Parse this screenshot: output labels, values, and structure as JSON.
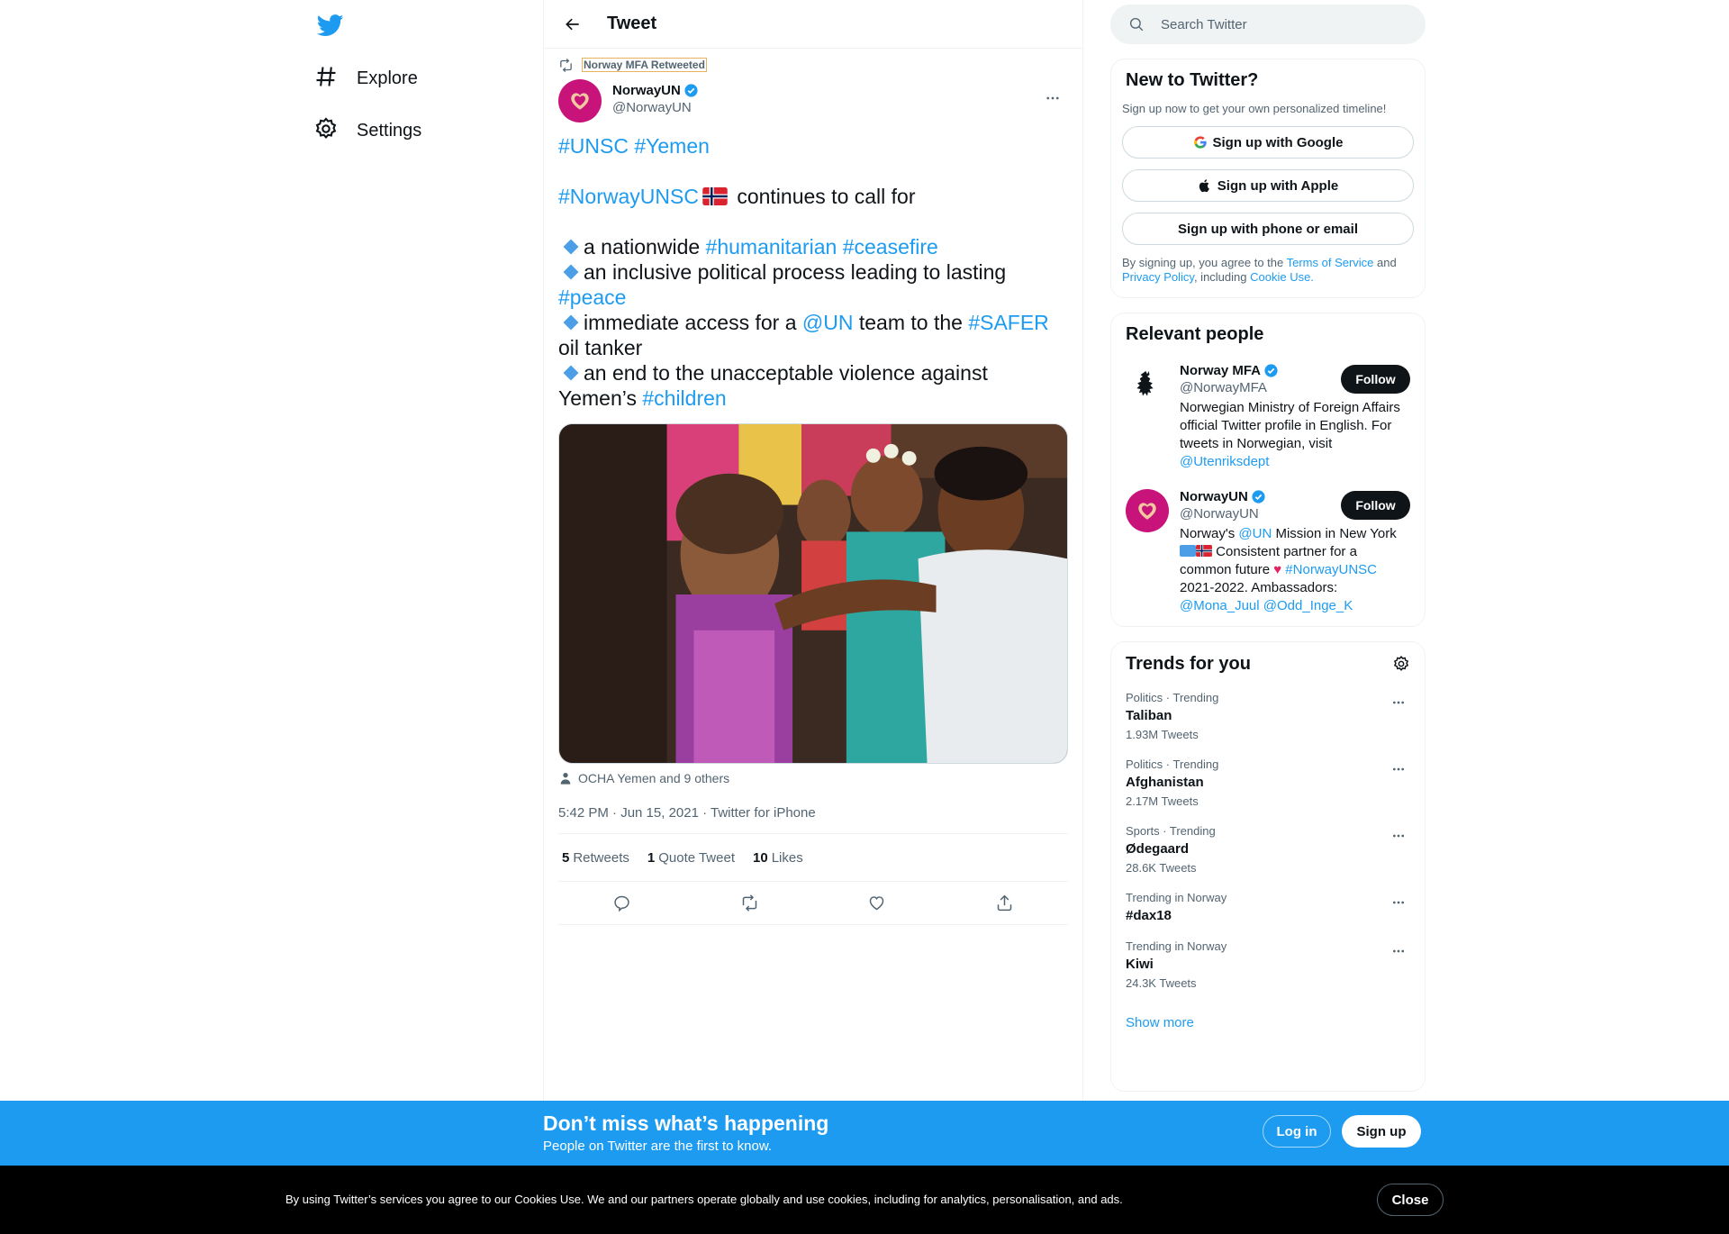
{
  "nav": {
    "explore": "Explore",
    "settings": "Settings"
  },
  "header": {
    "title": "Tweet"
  },
  "tweet": {
    "retweeted_by": "Norway MFA Retweeted",
    "author_name": "NorwayUN",
    "author_handle": "@NorwayUN",
    "text": {
      "l1_tag1": "#UNSC",
      "l1_tag2": "#Yemen",
      "l2_tag": "#NorwayUNSC",
      "l2_rest": " continues to call for",
      "b1_pre": "a nationwide ",
      "b1_tag1": "#humanitarian",
      "b1_tag2": "#ceasefire",
      "b2_pre": "an inclusive political process leading to lasting ",
      "b2_tag": "#peace",
      "b3_pre": "immediate access for a ",
      "b3_mention": "@UN",
      "b3_mid": " team to the ",
      "b3_tag": "#SAFER",
      "b3_post": " oil tanker",
      "b4_pre": "an end to the unacceptable violence against Yemen’s ",
      "b4_tag": "#children"
    },
    "tagged": "OCHA Yemen and 9 others",
    "meta": "5:42 PM · Jun 15, 2021 · Twitter for iPhone",
    "stats": {
      "retweets_count": "5",
      "retweets_label": "Retweets",
      "quotes_count": "1",
      "quotes_label": "Quote Tweet",
      "likes_count": "10",
      "likes_label": "Likes"
    }
  },
  "search": {
    "placeholder": "Search Twitter"
  },
  "new_to_twitter": {
    "title": "New to Twitter?",
    "subtitle": "Sign up now to get your own personalized timeline!",
    "google": "Sign up with Google",
    "apple": "Sign up with Apple",
    "phone_email": "Sign up with phone or email",
    "legal_pre": "By signing up, you agree to the ",
    "terms": "Terms of Service",
    "and": " and ",
    "privacy": "Privacy Policy",
    "including": ", including ",
    "cookie": "Cookie Use."
  },
  "relevant_people": {
    "title": "Relevant people",
    "people": [
      {
        "name": "Norway MFA",
        "handle": "@NorwayMFA",
        "bio": "Norwegian Ministry of Foreign Affairs official Twitter profile in English. For tweets in Norwegian, visit ",
        "bio_mention": "@Utenriksdept",
        "follow": "Follow"
      },
      {
        "name": "NorwayUN",
        "handle": "@NorwayUN",
        "bio_pre": "Norway's ",
        "bio_mention": "@UN",
        "bio_mid": " Mission in New York ",
        "bio_mid2": " Consistent partner for a common future ",
        "bio_tag": "#NorwayUNSC",
        "bio_post": " 2021-2022. Ambassadors: ",
        "bio_m1": "@Mona_Juul",
        "bio_m2": "@Odd_Inge_K",
        "follow": "Follow"
      }
    ]
  },
  "trends": {
    "title": "Trends for you",
    "items": [
      {
        "category": "Politics · Trending",
        "name": "Taliban",
        "count": "1.93M Tweets"
      },
      {
        "category": "Politics · Trending",
        "name": "Afghanistan",
        "count": "2.17M Tweets"
      },
      {
        "category": "Sports · Trending",
        "name": "Ødegaard",
        "count": "28.6K Tweets"
      },
      {
        "category": "Trending in Norway",
        "name": "#dax18",
        "count": ""
      },
      {
        "category": "Trending in Norway",
        "name": "Kiwi",
        "count": "24.3K Tweets"
      }
    ],
    "show_more": "Show more"
  },
  "bottom_bar": {
    "title": "Don’t miss what’s happening",
    "subtitle": "People on Twitter are the first to know.",
    "login": "Log in",
    "signup": "Sign up"
  },
  "cookie_bar": {
    "text": "By using Twitter’s services you agree to our Cookies Use. We and our partners operate globally and use cookies, including for analytics, personalisation, and ads.",
    "close": "Close"
  },
  "colors": {
    "accent": "#1d9bf0",
    "text": "#0f1419",
    "muted": "#536471",
    "avatar_un": "#c8137a"
  }
}
